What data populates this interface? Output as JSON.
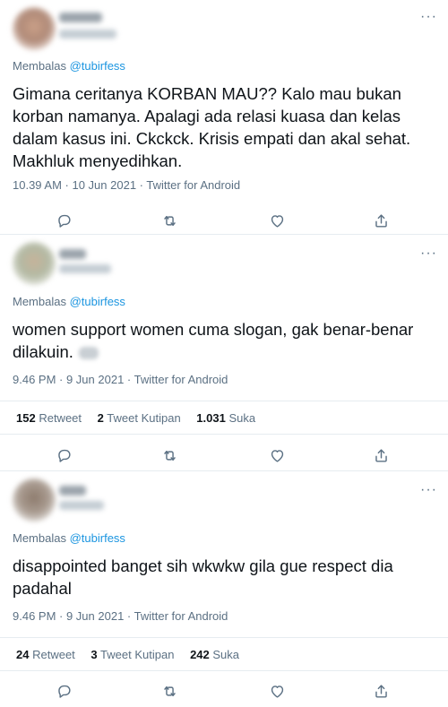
{
  "reply_prefix": "Membalas",
  "tweets": [
    {
      "reply_to": "@tubirfess",
      "text": "Gimana ceritanya KORBAN MAU?? Kalo mau bukan korban namanya. Apalagi ada relasi kuasa dan kelas dalam kasus ini. Ckckck. Krisis empati dan akal sehat. Makhluk menyedihkan.",
      "meta": "10.39 AM · 10 Jun 2021 · Twitter for Android"
    },
    {
      "reply_to": "@tubirfess",
      "text": "women support women cuma slogan, gak benar-benar dilakuin.",
      "meta": "9.46 PM · 9 Jun 2021 · Twitter for Android",
      "stats": {
        "retweets": "152",
        "retweets_label": "Retweet",
        "quotes": "2",
        "quotes_label": "Tweet Kutipan",
        "likes": "1.031",
        "likes_label": "Suka"
      }
    },
    {
      "reply_to": "@tubirfess",
      "text": "disappointed banget sih wkwkw gila gue respect dia padahal",
      "meta": "9.46 PM · 9 Jun 2021 · Twitter for Android",
      "stats": {
        "retweets": "24",
        "retweets_label": "Retweet",
        "quotes": "3",
        "quotes_label": "Tweet Kutipan",
        "likes": "242",
        "likes_label": "Suka"
      }
    }
  ],
  "icons": {
    "more": "more-icon",
    "reply": "reply-icon",
    "retweet": "retweet-icon",
    "like": "like-icon",
    "share": "share-icon"
  },
  "colors": {
    "text": "#0f1419",
    "secondary": "#5b7083",
    "mention": "#1b95e0",
    "divider": "#e6ecf0"
  }
}
